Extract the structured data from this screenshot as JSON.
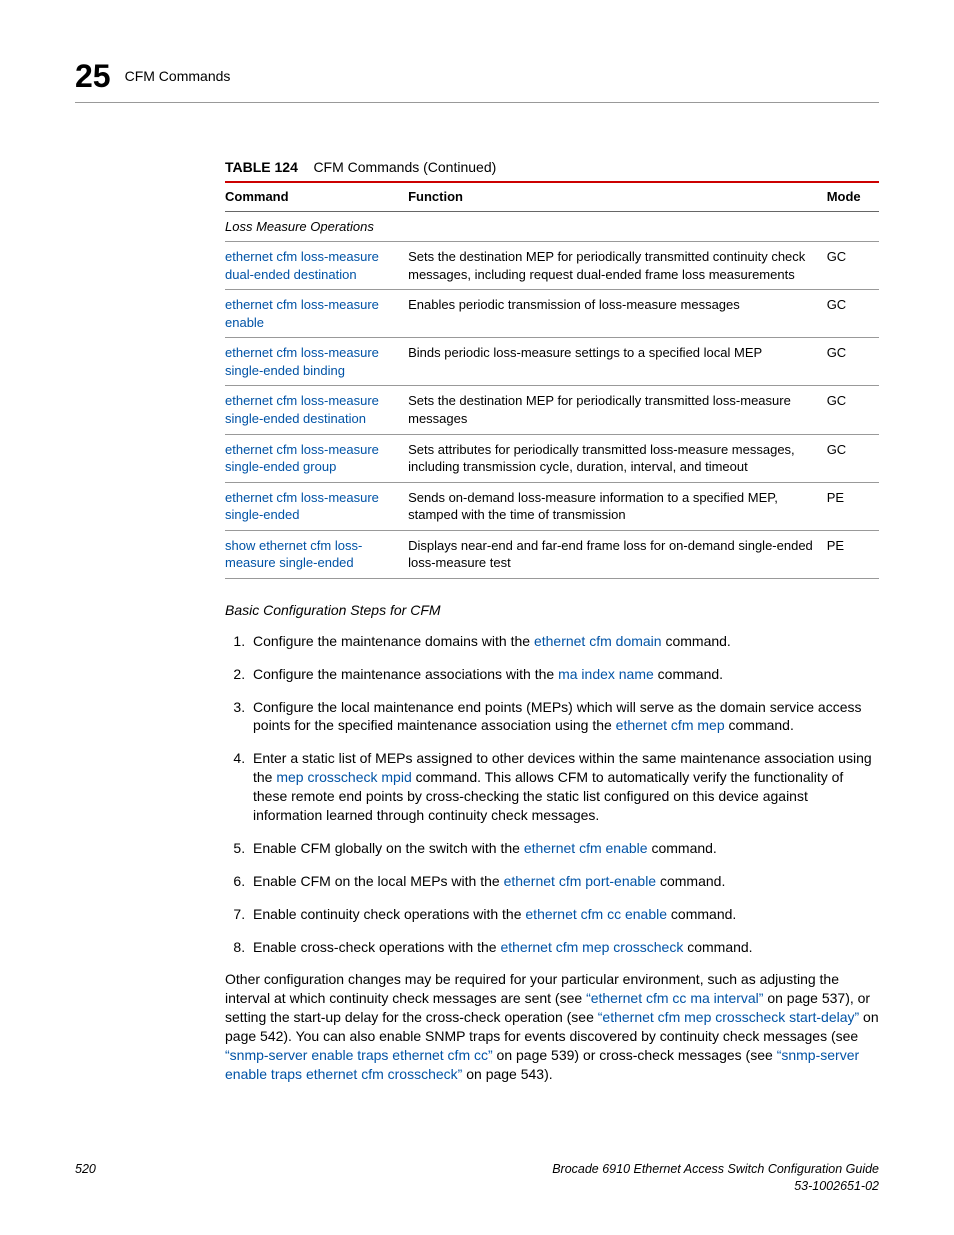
{
  "header": {
    "chapter_number": "25",
    "chapter_title": "CFM Commands"
  },
  "table": {
    "label": "TABLE 124",
    "caption": "CFM Commands (Continued)",
    "headers": {
      "c1": "Command",
      "c2": "Function",
      "c3": "Mode"
    },
    "section_label": "Loss Measure Operations",
    "rows": [
      {
        "cmd": "ethernet cfm loss-measure dual-ended destination",
        "fn": "Sets the destination MEP for periodically transmitted continuity check messages, including request dual-ended frame loss measurements",
        "mode": "GC"
      },
      {
        "cmd": "ethernet cfm loss-measure enable",
        "fn": "Enables periodic transmission of loss-measure messages",
        "mode": "GC"
      },
      {
        "cmd": "ethernet cfm loss-measure single-ended binding",
        "fn": "Binds periodic loss-measure settings to a specified local MEP",
        "mode": "GC"
      },
      {
        "cmd": "ethernet cfm loss-measure single-ended destination",
        "fn": "Sets the destination MEP for periodically transmitted loss-measure messages",
        "mode": "GC"
      },
      {
        "cmd": "ethernet cfm loss-measure single-ended group",
        "fn": "Sets attributes for periodically transmitted loss-measure messages, including transmission cycle, duration, interval, and timeout",
        "mode": "GC"
      },
      {
        "cmd": "ethernet cfm loss-measure single-ended",
        "fn": "Sends on-demand loss-measure information to a specified MEP, stamped with the time of transmission",
        "mode": "PE"
      },
      {
        "cmd": "show ethernet cfm loss-measure single-ended",
        "fn": "Displays near-end and far-end frame loss for on-demand single-ended loss-measure test",
        "mode": "PE"
      }
    ]
  },
  "steps_heading": "Basic Configuration Steps for CFM",
  "steps": {
    "s1a": "Configure the maintenance domains with the ",
    "s1link": "ethernet cfm domain",
    "s1b": " command.",
    "s2a": "Configure the maintenance associations with the ",
    "s2link": "ma index name",
    "s2b": " command.",
    "s3a": "Configure the local maintenance end points (MEPs) which will serve as the domain service access points for the specified maintenance association using the ",
    "s3link": "ethernet cfm mep",
    "s3b": " command.",
    "s4a": "Enter a static list of MEPs assigned to other devices within the same maintenance association using the ",
    "s4link": "mep crosscheck mpid",
    "s4b": " command. This allows CFM to automatically verify the functionality of these remote end points by cross-checking the static list configured on this device against information learned through continuity check messages.",
    "s5a": "Enable CFM globally on the switch with the ",
    "s5link": "ethernet cfm enable",
    "s5b": " command.",
    "s6a": "Enable CFM on the local MEPs with the ",
    "s6link": "ethernet cfm port-enable",
    "s6b": " command.",
    "s7a": "Enable continuity check operations with the ",
    "s7link": "ethernet cfm cc enable",
    "s7b": " command.",
    "s8a": "Enable cross-check operations with the ",
    "s8link": "ethernet cfm mep crosscheck",
    "s8b": " command."
  },
  "closing": {
    "p1": "Other configuration changes may be required for your particular environment, such as adjusting the interval at which continuity check messages are sent (see ",
    "l1": "“ethernet cfm cc ma interval”",
    "p2": " on page 537), or setting the start-up delay for the cross-check operation (see ",
    "l2": "“ethernet cfm mep crosscheck start-delay”",
    "p3": " on page 542). You can also enable SNMP traps for events discovered by continuity check messages (see ",
    "l3": "“snmp-server enable traps ethernet cfm cc”",
    "p4": " on page 539) or cross-check messages (see ",
    "l4": "“snmp-server enable traps ethernet cfm crosscheck”",
    "p5": " on page 543)."
  },
  "footer": {
    "page": "520",
    "doc": "Brocade 6910 Ethernet Access Switch Configuration Guide",
    "docnum": "53-1002651-02"
  }
}
